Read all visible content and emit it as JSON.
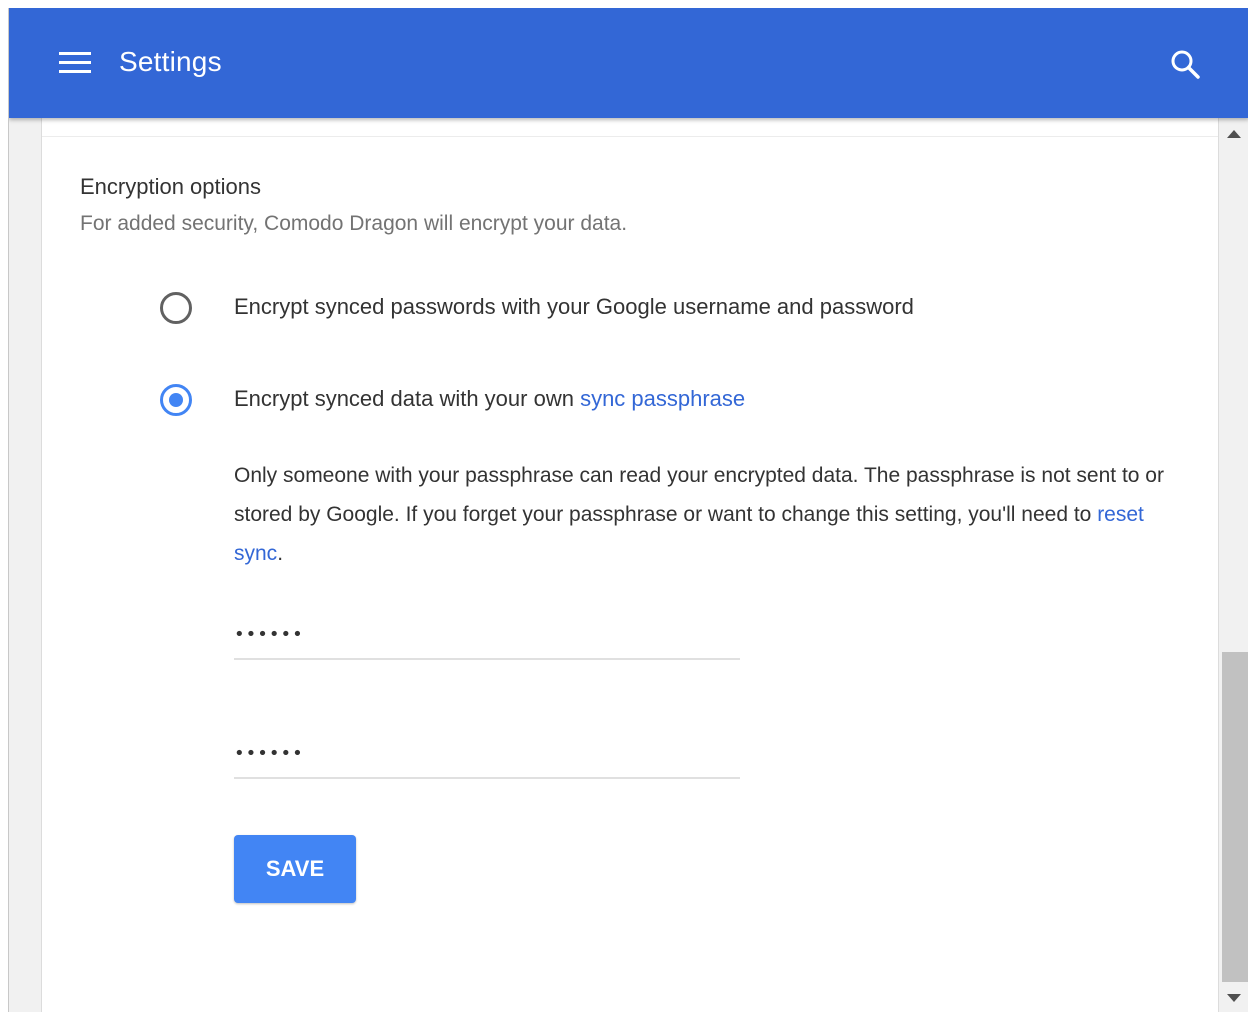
{
  "header": {
    "title": "Settings",
    "menu_icon": "hamburger-menu-icon",
    "search_icon": "search-icon",
    "color": "#3367d6"
  },
  "encryption": {
    "title": "Encryption options",
    "subtitle": "For added security, Comodo Dragon will encrypt your data.",
    "options": [
      {
        "label": "Encrypt synced passwords with your Google username and password",
        "selected": false
      },
      {
        "label_prefix": "Encrypt synced data with your own ",
        "label_link": "sync passphrase",
        "selected": true
      }
    ],
    "description_prefix": "Only someone with your passphrase can read your encrypted data. The passphrase is not sent to or stored by Google. If you forget your passphrase or want to change this setting, you'll need to ",
    "description_link": "reset sync",
    "description_suffix": ".",
    "passphrase_value": "••••••",
    "confirm_value": "••••••",
    "save_label": "SAVE",
    "accent_color": "#4285f4",
    "link_color": "#3367d6"
  }
}
